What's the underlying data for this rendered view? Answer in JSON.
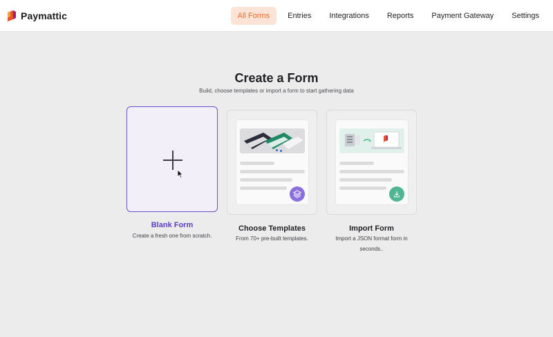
{
  "header": {
    "brand": "Paymattic",
    "nav": [
      {
        "label": "All Forms",
        "active": true
      },
      {
        "label": "Entries",
        "active": false
      },
      {
        "label": "Integrations",
        "active": false
      },
      {
        "label": "Reports",
        "active": false
      },
      {
        "label": "Payment Gateway",
        "active": false
      },
      {
        "label": "Settings",
        "active": false
      }
    ]
  },
  "hero": {
    "title": "Create a Form",
    "subtitle": "Build, choose templates or import a form to start gathering data"
  },
  "cards": [
    {
      "title": "Blank Form",
      "desc_lines": [
        "Create a fresh one from scratch."
      ],
      "icon": "plus-icon",
      "selected": true
    },
    {
      "title": "Choose Templates",
      "desc_lines": [
        "From 70+ pre-built templates."
      ],
      "icon": "layers-icon",
      "selected": false
    },
    {
      "title": "Import Form",
      "desc_lines": [
        "Import a JSON format form in",
        "seconds.."
      ],
      "icon": "download-icon",
      "selected": false
    }
  ],
  "colors": {
    "accent": "#6d4ec9",
    "nav_active_bg": "#fbe3d6",
    "nav_active_text": "#ea6a2a",
    "templates_badge": "#8b6fde",
    "import_badge": "#4fb592"
  }
}
